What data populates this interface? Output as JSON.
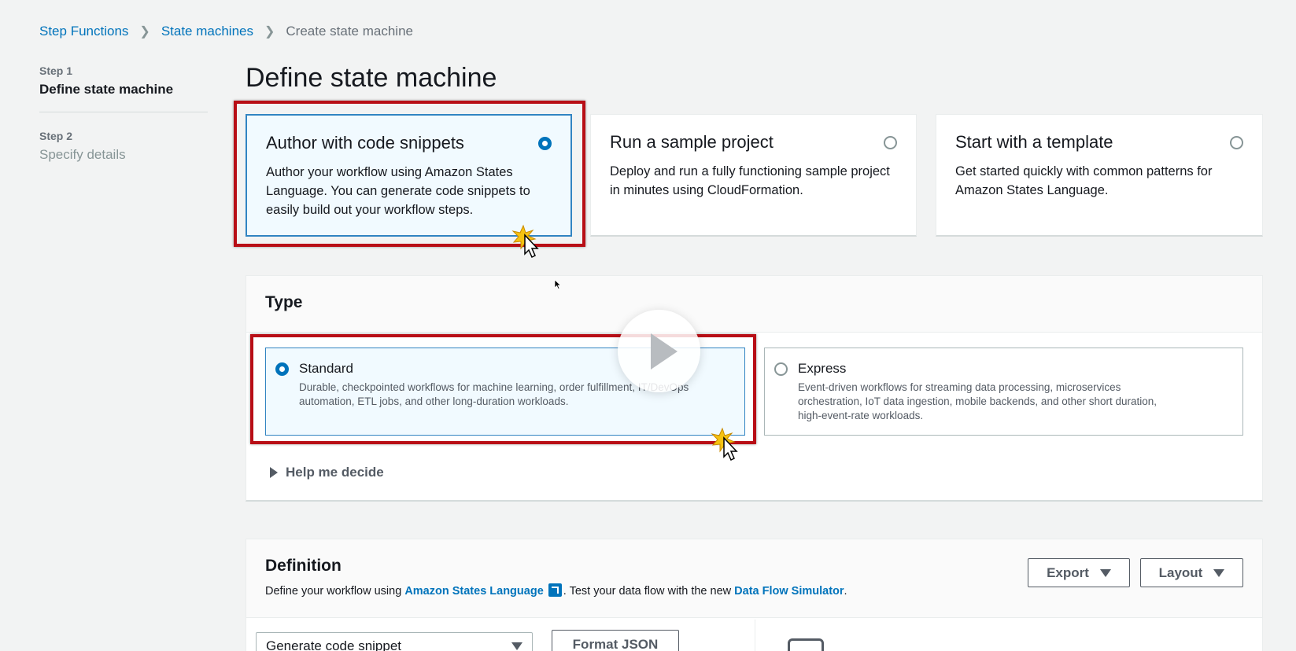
{
  "breadcrumb": {
    "items": [
      "Step Functions",
      "State machines"
    ],
    "current": "Create state machine"
  },
  "steps": [
    {
      "num": "Step 1",
      "title": "Define state machine"
    },
    {
      "num": "Step 2",
      "title": "Specify details"
    }
  ],
  "page_title": "Define state machine",
  "tiles": [
    {
      "title": "Author with code snippets",
      "desc": "Author your workflow using Amazon States Language. You can generate code snippets to easily build out your workflow steps.",
      "selected": true
    },
    {
      "title": "Run a sample project",
      "desc": "Deploy and run a fully functioning sample project in minutes using CloudFormation.",
      "selected": false
    },
    {
      "title": "Start with a template",
      "desc": "Get started quickly with common patterns for Amazon States Language.",
      "selected": false
    }
  ],
  "type_panel": {
    "heading": "Type",
    "options": [
      {
        "title": "Standard",
        "desc": "Durable, checkpointed workflows for machine learning, order fulfillment, IT/DevOps automation, ETL jobs, and other long-duration workloads.",
        "selected": true
      },
      {
        "title": "Express",
        "desc": "Event-driven workflows for streaming data processing, microservices orchestration, IoT data ingestion, mobile backends, and other short duration, high-event-rate workloads.",
        "selected": false
      }
    ],
    "help_label": "Help me decide"
  },
  "definition": {
    "heading": "Definition",
    "desc_prefix": "Define your workflow using ",
    "asl_link": "Amazon States Language",
    "desc_mid": ". Test your data flow with the new ",
    "sim_link": "Data Flow Simulator",
    "desc_suffix": ".",
    "export_label": "Export",
    "layout_label": "Layout",
    "snippet_select": "Generate code snippet",
    "format_json_label": "Format JSON"
  },
  "colors": {
    "highlight": "#b80e16",
    "link": "#0073bb",
    "selected_bg": "#f1faff"
  }
}
